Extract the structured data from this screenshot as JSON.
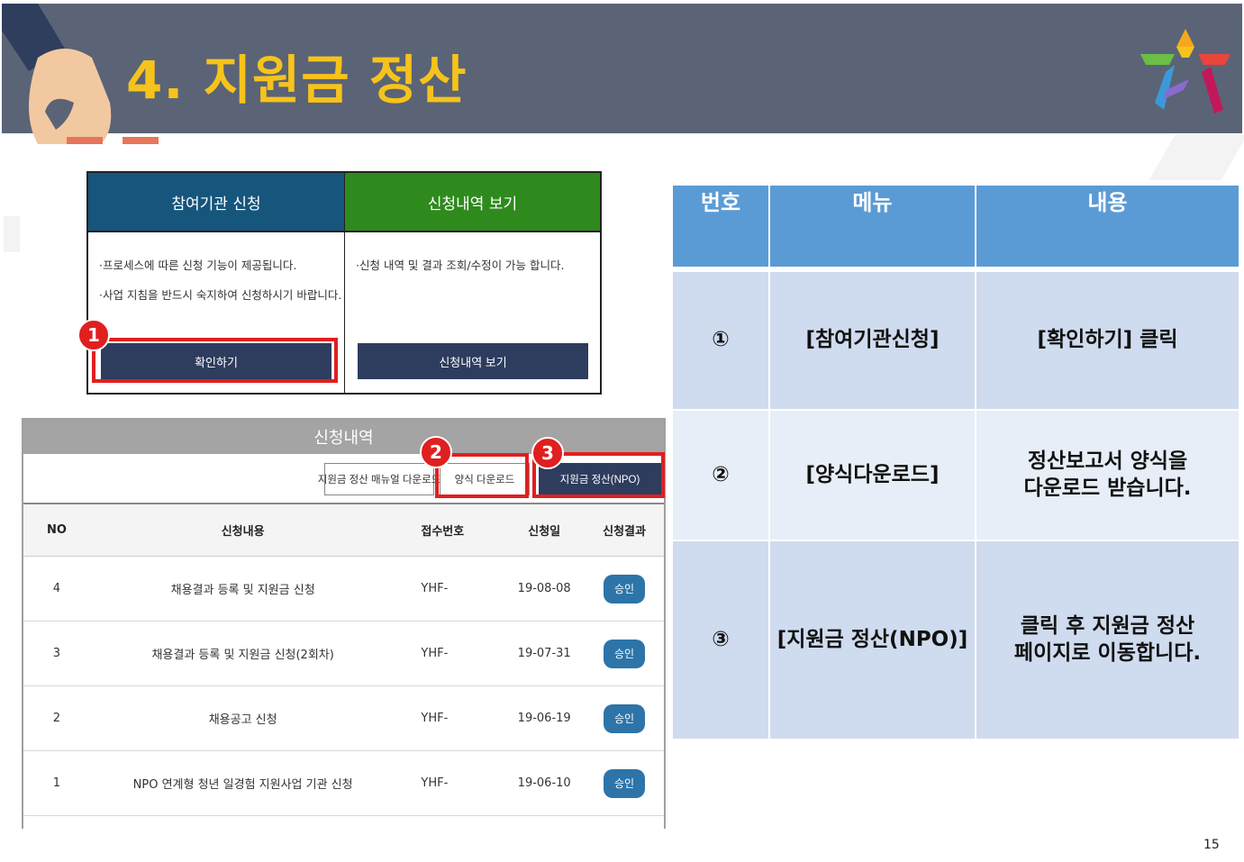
{
  "slide": {
    "title": "4. 지원금 정산",
    "page_number": "15",
    "colors": {
      "header_bg": "#5a6476",
      "title": "#f6c31c",
      "highlight": "#e01f1f"
    }
  },
  "top_card": {
    "left": {
      "header": "참여기관 신청",
      "lines": [
        "·프로세스에 따른 신청 기능이 제공됩니다.",
        "·사업 지침을 반드시 숙지하여 신청하시기 바랍니다."
      ],
      "button": "확인하기"
    },
    "right": {
      "header": "신청내역 보기",
      "lines": [
        "·신청 내역 및 결과 조회/수정이 가능 합니다."
      ],
      "button": "신청내역 보기"
    }
  },
  "callouts": [
    "1",
    "2",
    "3"
  ],
  "list": {
    "title": "신청내역",
    "toolbar": {
      "manual_download": "지원금 정산 매뉴얼 다운로드",
      "form_download": "양식 다운로드",
      "settlement_npo": "지원금 정산(NPO)"
    },
    "columns": [
      "NO",
      "신청내용",
      "접수번호",
      "신청일",
      "신청결과"
    ],
    "rows": [
      {
        "no": "4",
        "content": "채용결과 등록 및 지원금 신청",
        "receipt": "YHF-",
        "date": "19-08-08",
        "result": "승인"
      },
      {
        "no": "3",
        "content": "채용결과 등록 및 지원금 신청(2회차)",
        "receipt": "YHF-",
        "date": "19-07-31",
        "result": "승인"
      },
      {
        "no": "2",
        "content": "채용공고 신청",
        "receipt": "YHF-",
        "date": "19-06-19",
        "result": "승인"
      },
      {
        "no": "1",
        "content": "NPO 연계형 청년 일경험 지원사업 기관 신청",
        "receipt": "YHF-",
        "date": "19-06-10",
        "result": "승인"
      }
    ]
  },
  "info_table": {
    "headers": [
      "번호",
      "메뉴",
      "내용"
    ],
    "rows": [
      {
        "num": "①",
        "menu": "[참여기관신청]",
        "desc_1": "[확인하기] 클릭",
        "desc_2": ""
      },
      {
        "num": "②",
        "menu": "[양식다운로드]",
        "desc_1": "정산보고서 양식을",
        "desc_2": "다운로드 받습니다."
      },
      {
        "num": "③",
        "menu": "[지원금 정산(NPO)]",
        "desc_1": "클릭 후 지원금 정산",
        "desc_2": "페이지로 이동합니다."
      }
    ]
  }
}
